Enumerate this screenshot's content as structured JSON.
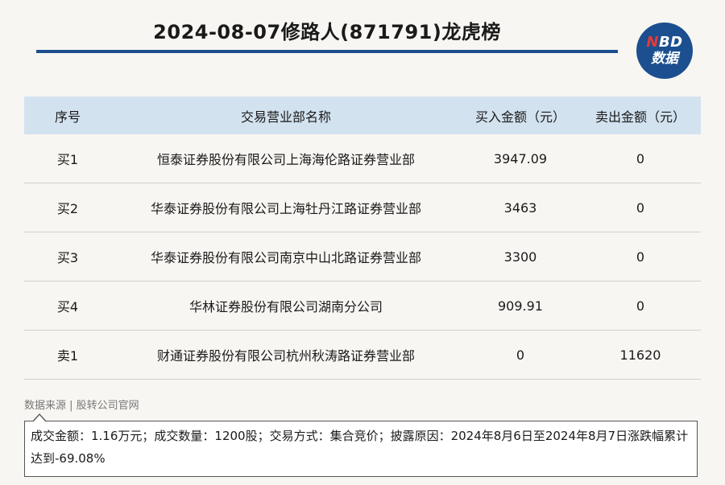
{
  "header": {
    "title": "2024-08-07修路人(871791)龙虎榜",
    "logo_line1_accent": "N",
    "logo_line1_rest": "BD",
    "logo_line2": "数据"
  },
  "table": {
    "columns": [
      "序号",
      "交易营业部名称",
      "买入金额（元）",
      "卖出金额（元）"
    ],
    "rows": [
      {
        "seq": "买1",
        "name": "恒泰证券股份有限公司上海海伦路证券营业部",
        "buy": "3947.09",
        "sell": "0"
      },
      {
        "seq": "买2",
        "name": "华泰证券股份有限公司上海牡丹江路证券营业部",
        "buy": "3463",
        "sell": "0"
      },
      {
        "seq": "买3",
        "name": "华泰证券股份有限公司南京中山北路证券营业部",
        "buy": "3300",
        "sell": "0"
      },
      {
        "seq": "买4",
        "name": "华林证券股份有限公司湖南分公司",
        "buy": "909.91",
        "sell": "0"
      },
      {
        "seq": "卖1",
        "name": "财通证券股份有限公司杭州秋涛路证券营业部",
        "buy": "0",
        "sell": "11620"
      }
    ]
  },
  "source": "数据来源 | 股转公司官网",
  "note": "成交金额：1.16万元；成交数量：1200股；交易方式：集合竞价；披露原因：2024年8月6日至2024年8月7日涨跌幅累计达到-69.08%",
  "colors": {
    "accent": "#1c4f8f",
    "header_bg": "#d3e2ef",
    "logo_red": "#e53935",
    "page_bg": "#f8f6f2"
  }
}
